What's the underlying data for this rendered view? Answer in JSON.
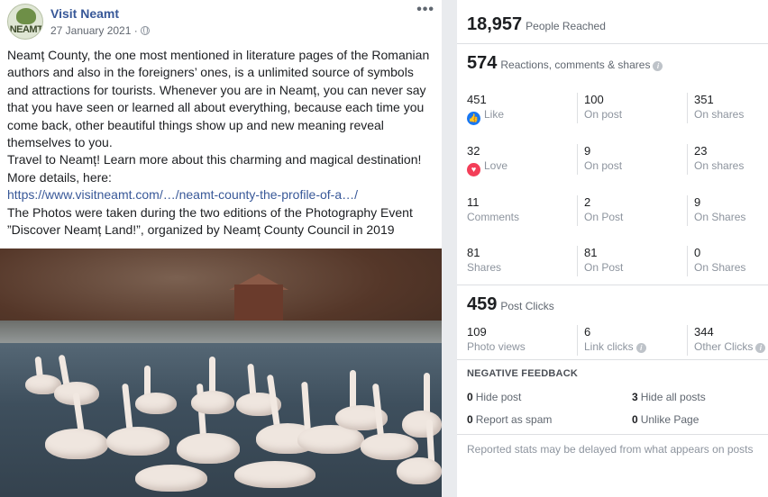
{
  "post": {
    "page_name": "Visit Neamt",
    "date": "27 January 2021 ·",
    "avatar_text": "NEAMT",
    "more_label": "•••",
    "text_lines": [
      "Neamț County, the one most mentioned in literature pages of the Romanian",
      "authors and also in the foreigners’ ones, is a unlimited source of symbols",
      "and attractions for tourists. Whenever you are in Neamț, you can never say",
      "that you have seen or learned all about everything, because each time you",
      "come back, other beautiful things show up and new meaning reveal",
      "themselves to you.",
      "Travel to Neamț! Learn more about this charming and magical destination!",
      "More details, here:"
    ],
    "link": "https://www.visitneamt.com/…/neamt-county-the-profile-of-a…/",
    "text_after": [
      "The Photos were taken during the two editions of the Photography Event",
      "”Discover Neamț Land!”, organized by Neamț County Council in 2019"
    ]
  },
  "insights": {
    "reached": {
      "value": "18,957",
      "label": "People Reached"
    },
    "engagement": {
      "value": "574",
      "label": "Reactions, comments & shares"
    },
    "rows": [
      {
        "c1": {
          "n": "451",
          "l": "Like",
          "icon": "like-icon"
        },
        "c2": {
          "n": "100",
          "l": "On post"
        },
        "c3": {
          "n": "351",
          "l": "On shares"
        }
      },
      {
        "c1": {
          "n": "32",
          "l": "Love",
          "icon": "love-icon"
        },
        "c2": {
          "n": "9",
          "l": "On post"
        },
        "c3": {
          "n": "23",
          "l": "On shares"
        }
      },
      {
        "c1": {
          "n": "11",
          "l": "Comments"
        },
        "c2": {
          "n": "2",
          "l": "On Post"
        },
        "c3": {
          "n": "9",
          "l": "On Shares"
        }
      },
      {
        "c1": {
          "n": "81",
          "l": "Shares"
        },
        "c2": {
          "n": "81",
          "l": "On Post"
        },
        "c3": {
          "n": "0",
          "l": "On Shares"
        }
      }
    ],
    "clicks": {
      "value": "459",
      "label": "Post Clicks"
    },
    "click_row": {
      "c1": {
        "n": "109",
        "l": "Photo views"
      },
      "c2": {
        "n": "6",
        "l": "Link clicks"
      },
      "c3": {
        "n": "344",
        "l": "Other Clicks"
      }
    },
    "negative": {
      "title": "NEGATIVE FEEDBACK",
      "hide_post": {
        "n": "0",
        "l": "Hide post"
      },
      "hide_all": {
        "n": "3",
        "l": "Hide all posts"
      },
      "spam": {
        "n": "0",
        "l": "Report as spam"
      },
      "unlike": {
        "n": "0",
        "l": "Unlike Page"
      }
    },
    "footer": "Reported stats may be delayed from what appears on posts"
  }
}
